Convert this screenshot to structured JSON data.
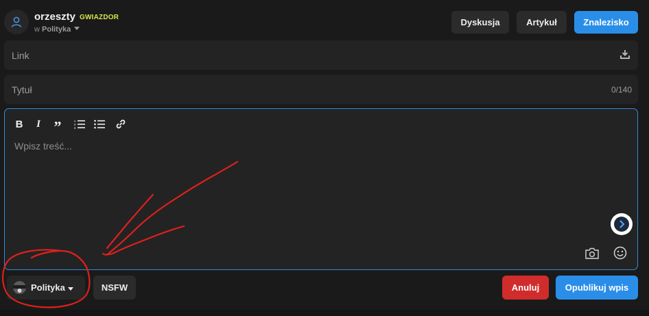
{
  "header": {
    "username": "orzeszty",
    "rank": "GWIAZDOR",
    "context_prefix": "w",
    "category": "Polityka"
  },
  "tabs": {
    "discussion": "Dyskusja",
    "article": "Artykuł",
    "find": "Znalezisko"
  },
  "link_field": {
    "placeholder": "Link",
    "icon": "download-icon"
  },
  "title_field": {
    "placeholder": "Tytuł",
    "counter": "0/140"
  },
  "editor": {
    "toolbar": [
      "bold-icon",
      "italic-icon",
      "quote-icon",
      "ordered-list-icon",
      "bullet-list-icon",
      "link-icon"
    ],
    "bold_glyph": "B",
    "italic_glyph": "I",
    "quote_glyph": "”",
    "placeholder": "Wpisz treść...",
    "ai_icon": "assistant-icon",
    "camera_icon": "camera-icon",
    "emoji_icon": "emoji-icon"
  },
  "footer": {
    "category_select": "Polityka",
    "nsfw": "NSFW",
    "cancel": "Anuluj",
    "publish": "Opublikuj wpis"
  },
  "colors": {
    "background": "#1a1a1a",
    "field": "#232323",
    "accent_blue": "#2a8ee8",
    "danger_red": "#d02c2c",
    "rank_yellow": "#d7e64a",
    "annotation_red": "#e0201c"
  }
}
